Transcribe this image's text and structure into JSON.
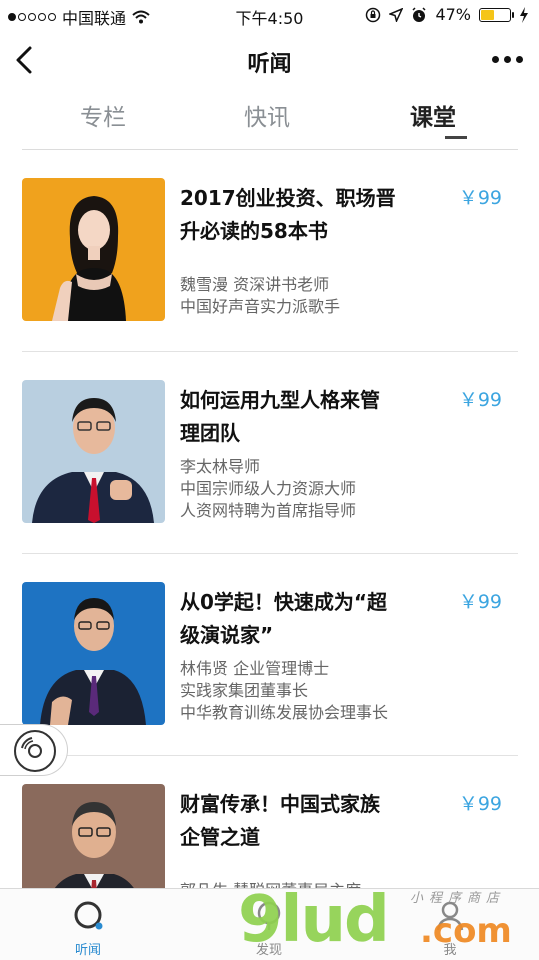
{
  "status_bar": {
    "carrier": "中国联通",
    "time": "下午4:50",
    "battery": "47%",
    "battery_level": 0.47,
    "icons": [
      "signal-icon",
      "wifi-icon",
      "rotation-lock-icon",
      "location-icon",
      "alarm-icon",
      "battery-icon",
      "charging-icon"
    ]
  },
  "nav": {
    "title": "听闻",
    "back_icon": "chevron-left-icon",
    "more_icon": "more-dots-icon"
  },
  "tabs": [
    {
      "label": "专栏"
    },
    {
      "label": "快讯"
    },
    {
      "label": "课堂",
      "active": true
    }
  ],
  "courses": [
    {
      "title": "2017创业投资、职场晋升必读的58本书",
      "title_lines": [
        "2017创业投资、职场晋",
        "升必读的58本书"
      ],
      "price": "￥99",
      "desc": [
        "魏雪漫 资深讲书老师",
        "中国好声音实力派歌手"
      ],
      "thumb_bg": "#f0a21d"
    },
    {
      "title": "如何运用九型人格来管理团队",
      "title_lines": [
        "如何运用九型人格来管",
        "理团队"
      ],
      "price": "￥99",
      "desc": [
        "李太林导师",
        "中国宗师级人力资源大师",
        "人资网特聘为首席指导师"
      ],
      "thumb_bg": "#b9cfe0"
    },
    {
      "title": "从0学起！快速成为“超级演说家”",
      "title_lines": [
        "从0学起！快速成为“超",
        "级演说家”"
      ],
      "price": "￥99",
      "desc": [
        "林伟贤 企业管理博士",
        "实践家集团董事长",
        "中华教育训练发展协会理事长"
      ],
      "thumb_bg": "#1e73c2"
    },
    {
      "title": "财富传承！中国式家族企管之道",
      "title_lines": [
        "财富传承！中国式家族",
        "企管之道"
      ],
      "price": "￥99",
      "desc": [
        "郭凡生 慧聪网董事局主席"
      ],
      "thumb_bg": "#8a6a5c"
    }
  ],
  "floating_player": {
    "icon": "audio-disc-icon"
  },
  "tabbar": [
    {
      "label": "听闻",
      "icon": "listen-circle-icon",
      "active": true
    },
    {
      "label": "发现",
      "icon": "discover-icon"
    },
    {
      "label": "我",
      "icon": "profile-icon"
    }
  ],
  "watermark": {
    "main": "9lud",
    "suffix": ".com",
    "sub": "小程序商店"
  },
  "colors": {
    "accent": "#3ca5e0",
    "tab_active": "#222222",
    "tab_inactive": "#8a8f94"
  }
}
